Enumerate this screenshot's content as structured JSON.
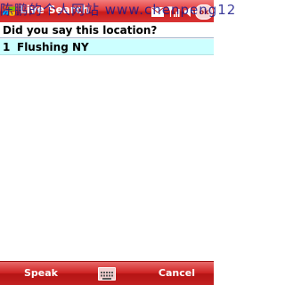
{
  "title_bar": {
    "app_title": "Live Search",
    "ok_label": "ok",
    "icons": [
      "start-flag-icon",
      "mail-icon",
      "antenna-icon",
      "speaker-icon"
    ]
  },
  "watermark": "陈鹏的个人网站 www.chenpeng12",
  "main": {
    "prompt": "Did you say this location?",
    "results": [
      {
        "number": "1",
        "label": "Flushing NY"
      }
    ]
  },
  "softkeys": {
    "left": "Speak",
    "right": "Cancel",
    "center_icon": "keyboard-icon"
  },
  "colors": {
    "accent": "#d42a2a",
    "selection": "#ccffff"
  }
}
